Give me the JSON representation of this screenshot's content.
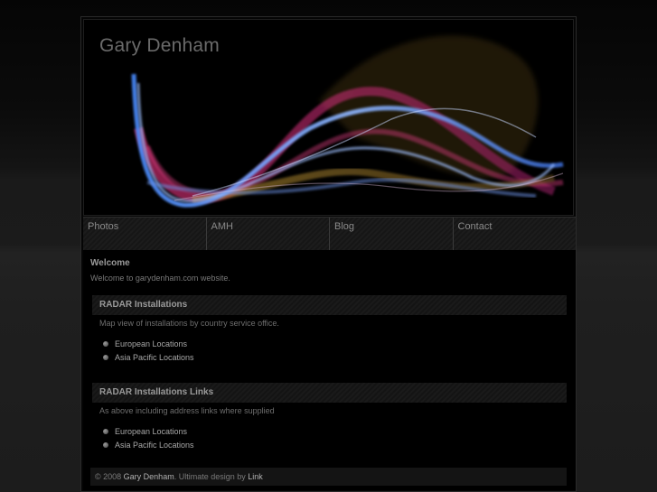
{
  "header": {
    "title": "Gary Denham"
  },
  "nav": [
    {
      "label": "Photos"
    },
    {
      "label": "AMH"
    },
    {
      "label": "Blog"
    },
    {
      "label": "Contact"
    }
  ],
  "welcome": {
    "title": "Welcome",
    "text": "Welcome to garydenham.com website."
  },
  "sections": [
    {
      "title": "RADAR Installations",
      "description": "Map view of installations by country service office.",
      "links": [
        "European Locations",
        "Asia Pacific Locations"
      ]
    },
    {
      "title": "RADAR Installations Links",
      "description": "As above including address links where supplied",
      "links": [
        "European Locations",
        "Asia Pacific Locations"
      ]
    }
  ],
  "footer": {
    "copyright": "© 2008",
    "author": "Gary Denham",
    "middle": ". Ultimate design by",
    "design_link": "Link"
  },
  "colors": {
    "background": "#121212",
    "panel": "#000000",
    "wave_blue": "#3b6fd6",
    "wave_pink": "#c0306a",
    "wave_gold": "#8a6a20"
  }
}
